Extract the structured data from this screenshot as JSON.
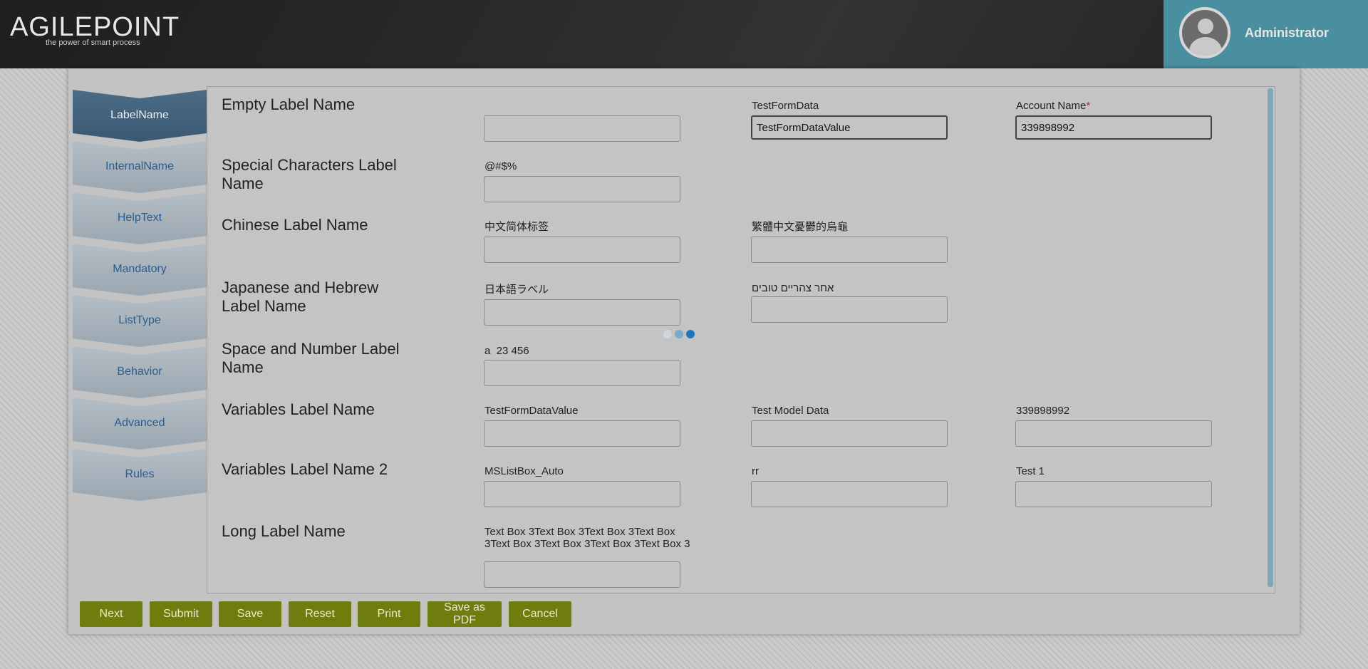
{
  "header": {
    "logo_text": "AGILEPOINT",
    "logo_tagline": "the power of smart process",
    "user_name": "Administrator"
  },
  "tabs": [
    {
      "label": "LabelName",
      "active": true
    },
    {
      "label": "InternalName",
      "active": false
    },
    {
      "label": "HelpText",
      "active": false
    },
    {
      "label": "Mandatory",
      "active": false
    },
    {
      "label": "ListType",
      "active": false
    },
    {
      "label": "Behavior",
      "active": false
    },
    {
      "label": "Advanced",
      "active": false
    },
    {
      "label": "Rules",
      "active": false
    }
  ],
  "rows": [
    {
      "label": "Empty Label Name"
    },
    {
      "label": "Special Characters Label Name"
    },
    {
      "label": "Chinese Label Name"
    },
    {
      "label": "Japanese and Hebrew Label Name"
    },
    {
      "label": "Space and Number Label Name"
    },
    {
      "label": "Variables Label Name"
    },
    {
      "label": "Variables Label Name 2"
    },
    {
      "label": "Long Label Name"
    }
  ],
  "fields": {
    "empty_label": {
      "label": "",
      "value": ""
    },
    "testformdata": {
      "label": "TestFormData",
      "value": "TestFormDataValue"
    },
    "account_name": {
      "label": "Account Name",
      "required_mark": "*",
      "value": "339898992"
    },
    "special_chars": {
      "label": "@#$%",
      "value": ""
    },
    "chinese_simplified": {
      "label": "中文简体标签",
      "value": ""
    },
    "chinese_traditional": {
      "label": "繁體中文憂鬱的烏龜",
      "value": ""
    },
    "japanese": {
      "label": "日本語ラベル",
      "value": ""
    },
    "hebrew": {
      "label": "אחר צהריים טובים",
      "value": ""
    },
    "space_number": {
      "label": "a  23 456",
      "value": ""
    },
    "var_testformdatavalue": {
      "label": "TestFormDataValue",
      "value": ""
    },
    "var_test_model_data": {
      "label": "Test Model Data",
      "value": ""
    },
    "var_339898992": {
      "label": "339898992",
      "value": ""
    },
    "var_mslistbox": {
      "label": "MSListBox_Auto",
      "value": ""
    },
    "var_rr": {
      "label": "rr",
      "value": ""
    },
    "var_test1": {
      "label": "Test 1",
      "value": ""
    },
    "long_label": {
      "label": "Text Box 3Text Box 3Text Box 3Text Box 3Text Box 3Text Box 3Text Box 3Text Box 3",
      "value": ""
    }
  },
  "buttons": {
    "next": "Next",
    "submit": "Submit",
    "save": "Save",
    "reset": "Reset",
    "print": "Print",
    "save_pdf": "Save as PDF",
    "cancel": "Cancel"
  },
  "colors": {
    "button_bg": "#6e7d0e",
    "header_bg": "#262626",
    "user_panel_bg": "#4a8fa0",
    "active_tab_bg": "#3f5d76",
    "tab_text": "#2a5d8f",
    "required": "#c0281e",
    "loader_dots": [
      "#d0d7dc",
      "#7aa9cc",
      "#1a78c2"
    ]
  }
}
